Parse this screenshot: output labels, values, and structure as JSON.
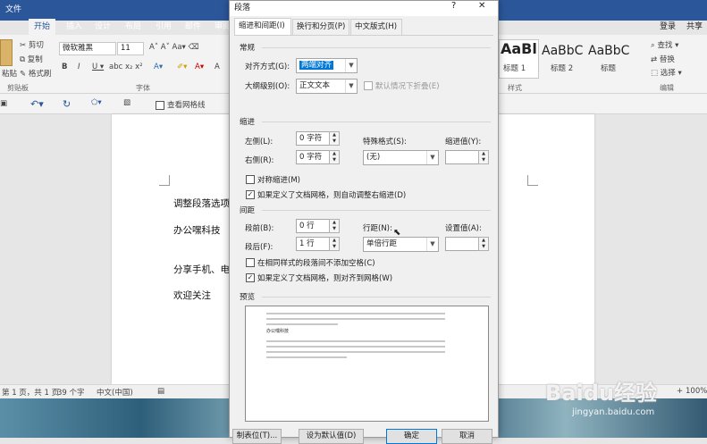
{
  "ribbon": {
    "tabs": [
      "文件",
      "开始",
      "插入",
      "设计",
      "布局",
      "引用",
      "邮件",
      "审阅"
    ],
    "active_tab": "开始",
    "right_labels": {
      "login": "登录",
      "share": "共享"
    },
    "clipboard": {
      "cut": "剪切",
      "copy": "复制",
      "paste": "粘贴",
      "format_painter": "格式刷",
      "group": "剪贴板"
    },
    "font": {
      "name": "微软雅黑",
      "size": "11",
      "group": "字体"
    },
    "styles": {
      "items": [
        {
          "preview": "AaBl",
          "label": "标题 1"
        },
        {
          "preview": "AaBbC",
          "label": "标题 2"
        },
        {
          "preview": "AaBbC",
          "label": "标题"
        }
      ],
      "group": "样式"
    },
    "editing": {
      "find": "查找",
      "replace": "替换",
      "select": "选择",
      "group": "编辑"
    }
  },
  "qat": {
    "view_gridlines": "查看网格线"
  },
  "document": {
    "lines": [
      "调整段落选项",
      "办公嘿科技",
      "分享手机、电",
      "欢迎关注"
    ]
  },
  "statusbar": {
    "page": "第 1 页，共 1 页",
    "words": "39 个字",
    "language": "中文(中国)",
    "zoom": "100%"
  },
  "watermark": {
    "text": "Baidu经验",
    "url": "jingyan.baidu.com"
  },
  "dialog": {
    "title": "段落",
    "help": "?",
    "close": "✕",
    "tabs": [
      "缩进和间距(I)",
      "换行和分页(P)",
      "中文版式(H)"
    ],
    "general": {
      "section": "常规",
      "alignment_label": "对齐方式(G):",
      "alignment_value": "两端对齐",
      "outline_label": "大纲级别(O):",
      "outline_value": "正文文本",
      "collapse_label": "默认情况下折叠(E)"
    },
    "indent": {
      "section": "缩进",
      "left_label": "左侧(L):",
      "left_value": "0 字符",
      "right_label": "右侧(R):",
      "right_value": "0 字符",
      "special_label": "特殊格式(S):",
      "special_value": "(无)",
      "by_label": "缩进值(Y):",
      "by_value": "",
      "mirror_label": "对称缩进(M)",
      "mirror_checked": false,
      "auto_right_label": "如果定义了文档网格，则自动调整右缩进(D)",
      "auto_right_checked": true
    },
    "spacing": {
      "section": "间距",
      "before_label": "段前(B):",
      "before_value": "0 行",
      "after_label": "段后(F):",
      "after_value": "1 行",
      "line_label": "行距(N):",
      "line_value": "单倍行距",
      "at_label": "设置值(A):",
      "at_value": "",
      "no_space_label": "在相同样式的段落间不添加空格(C)",
      "no_space_checked": false,
      "snap_label": "如果定义了文档网格，则对齐到网格(W)",
      "snap_checked": true
    },
    "preview": {
      "section": "预览",
      "sample": "办公嘿科技"
    },
    "buttons": {
      "tabs": "制表位(T)...",
      "default": "设为默认值(D)",
      "ok": "确定",
      "cancel": "取消"
    }
  }
}
